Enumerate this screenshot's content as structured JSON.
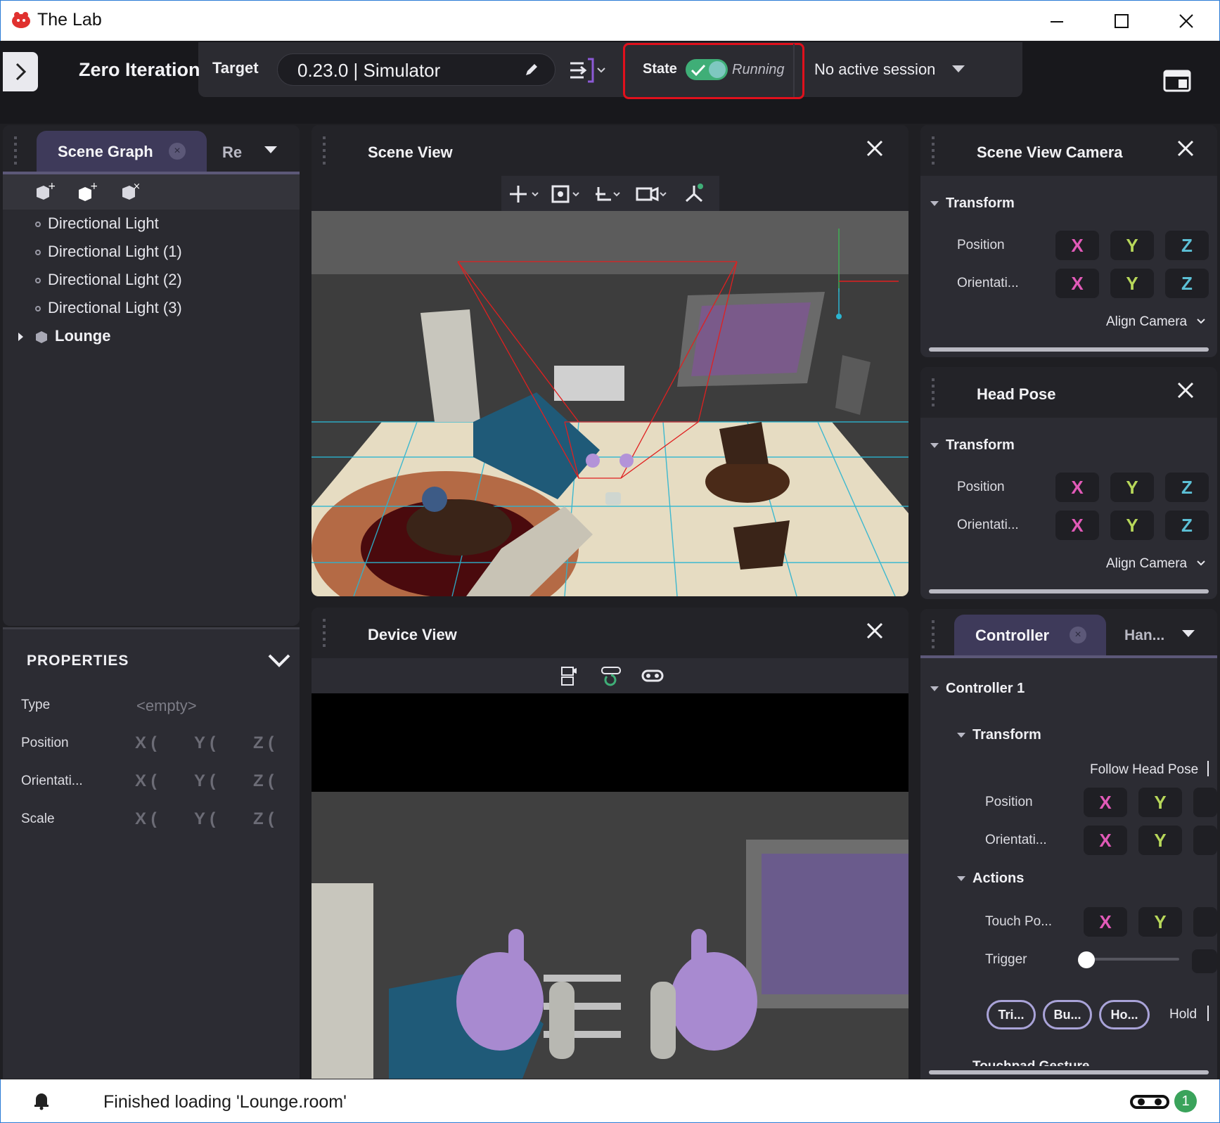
{
  "window": {
    "title": "The Lab"
  },
  "header": {
    "project": "Zero Iteration",
    "target_label": "Target",
    "target_value": "0.23.0 | Simulator",
    "state_label": "State",
    "state_value": "Running",
    "session": "No active session"
  },
  "scene_graph": {
    "tab": "Scene Graph",
    "tab2": "Re",
    "items": [
      "Directional Light",
      "Directional Light (1)",
      "Directional Light (2)",
      "Directional Light (3)"
    ],
    "group": "Lounge"
  },
  "properties": {
    "title": "PROPERTIES",
    "type_label": "Type",
    "type_value": "<empty>",
    "rows": [
      "Position",
      "Orientati...",
      "Scale"
    ],
    "axes": [
      "X (",
      "Y (",
      "Z ("
    ]
  },
  "scene_view": {
    "title": "Scene View"
  },
  "device_view": {
    "title": "Device View"
  },
  "scene_view_camera": {
    "title": "Scene View Camera",
    "section": "Transform",
    "position": "Position",
    "orientation": "Orientati...",
    "align": "Align Camera"
  },
  "head_pose": {
    "title": "Head Pose",
    "section": "Transform",
    "position": "Position",
    "orientation": "Orientati...",
    "align": "Align Camera"
  },
  "controller": {
    "tab": "Controller",
    "tab2": "Han...",
    "group": "Controller 1",
    "transform": "Transform",
    "follow": "Follow Head Pose",
    "position": "Position",
    "orientation": "Orientati...",
    "actions": "Actions",
    "touch": "Touch Po...",
    "trigger": "Trigger",
    "trigger_value": 0.0,
    "chips": [
      "Tri...",
      "Bu...",
      "Ho..."
    ],
    "hold": "Hold",
    "touchpad": "Touchpad Gesture"
  },
  "axis": {
    "x": "X",
    "y": "Y",
    "z": "Z"
  },
  "status": {
    "message": "Finished loading 'Lounge.room'",
    "count": "1"
  }
}
